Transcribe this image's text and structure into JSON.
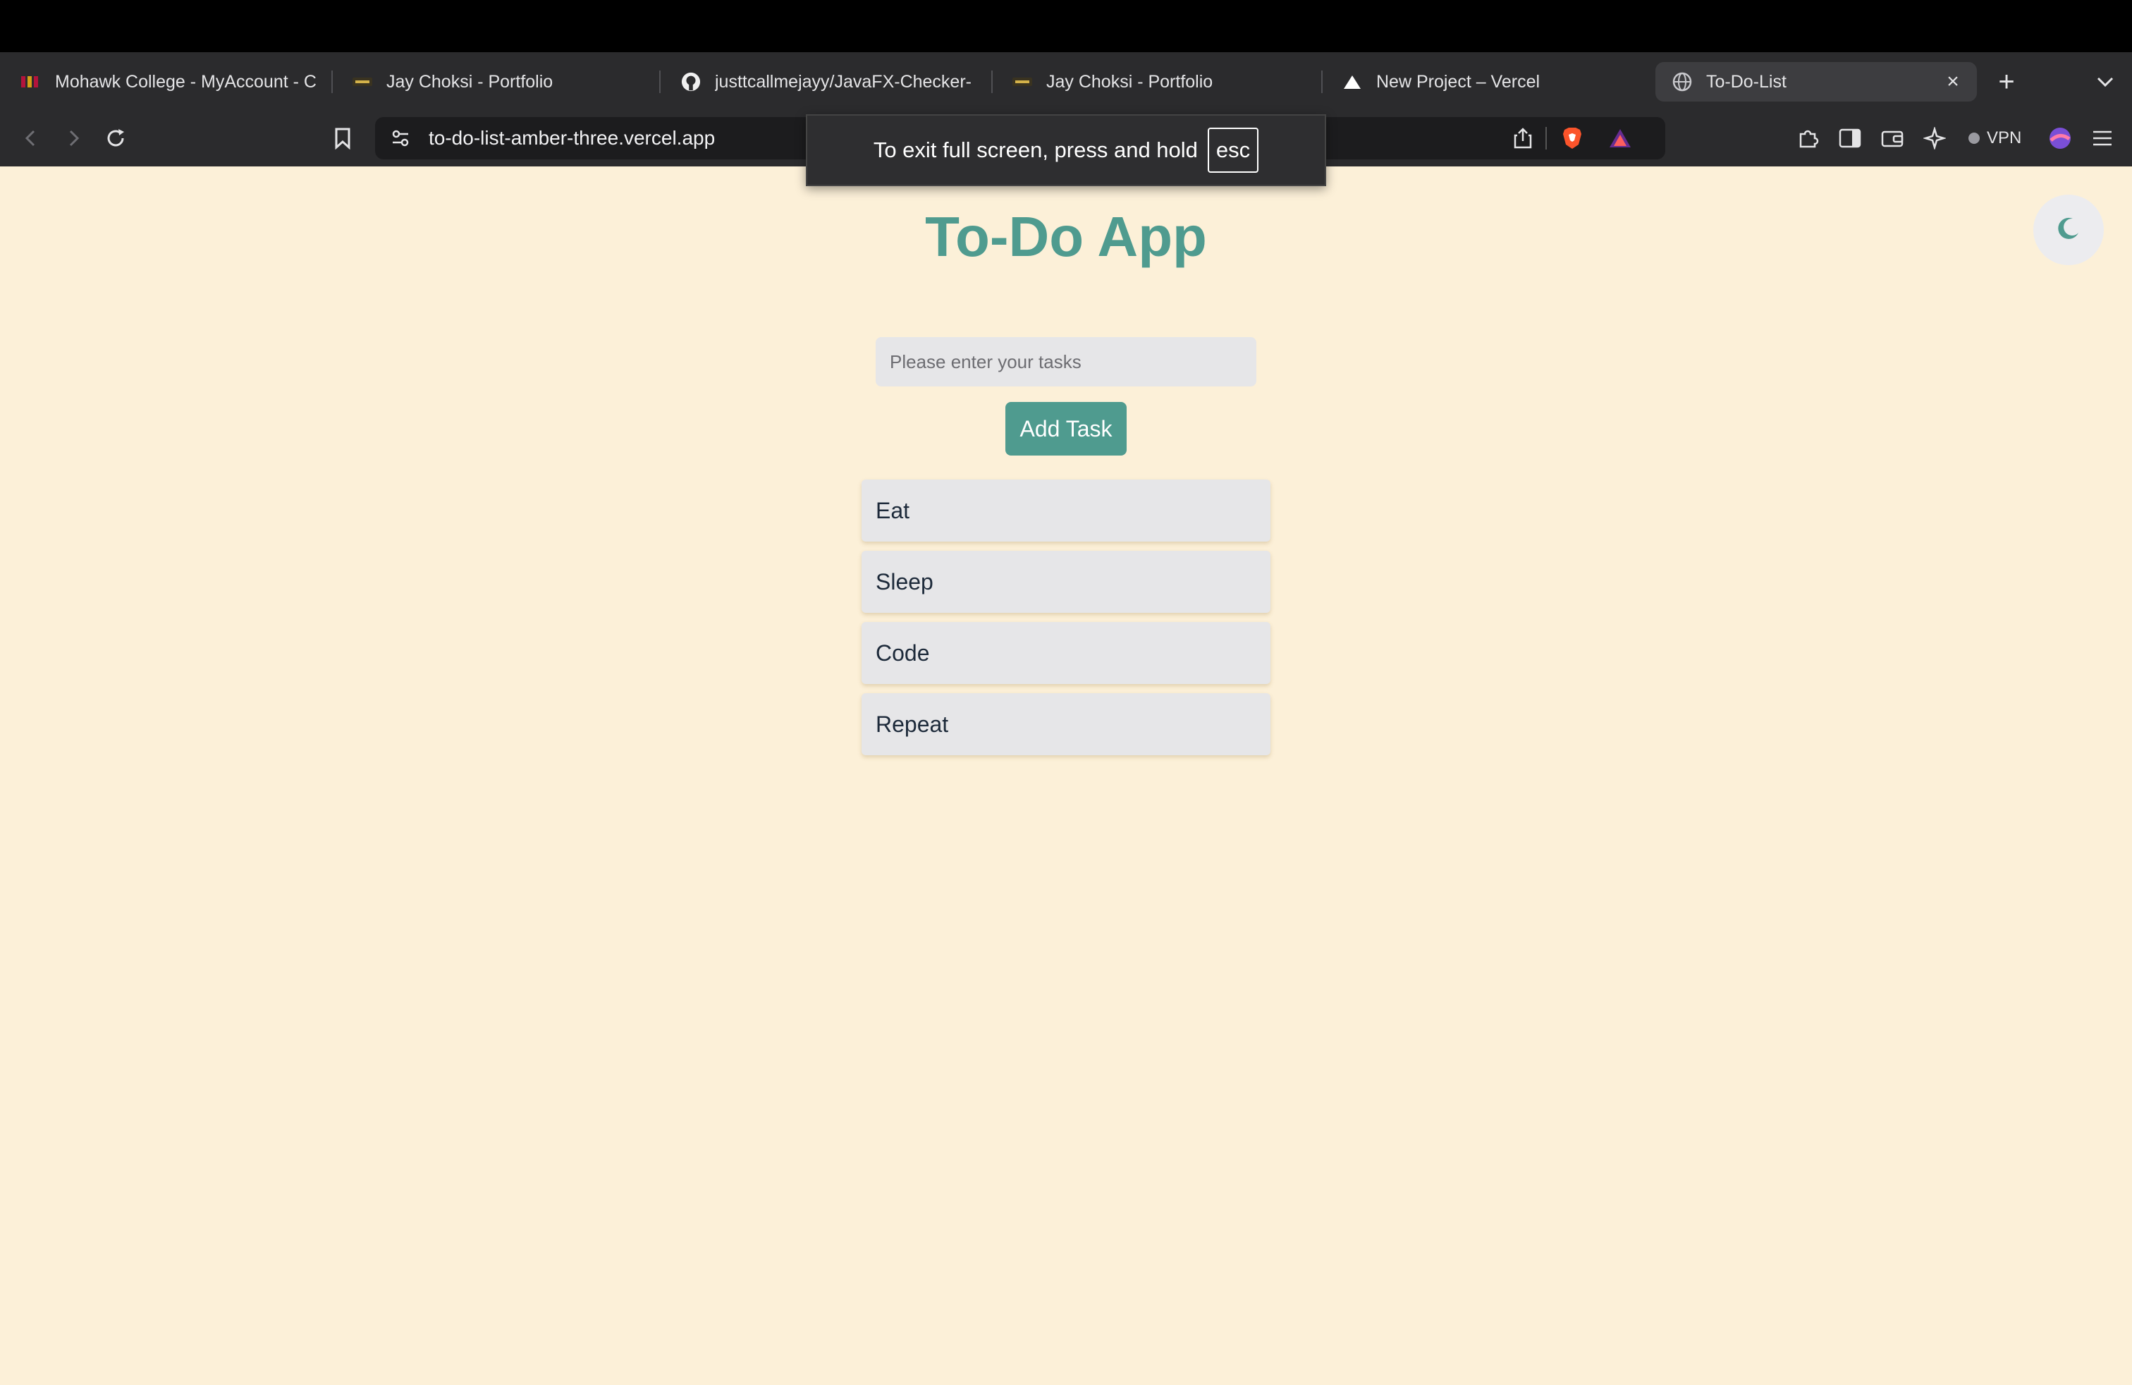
{
  "browser": {
    "tabs": [
      {
        "label": "Mohawk College - MyAccount - C",
        "icon": "mohawk-favicon"
      },
      {
        "label": "Jay Choksi - Portfolio",
        "icon": "portfolio-favicon"
      },
      {
        "label": "justtcallmejayy/JavaFX-Checker-",
        "icon": "github-icon"
      },
      {
        "label": "Jay Choksi - Portfolio",
        "icon": "portfolio-favicon"
      },
      {
        "label": "New Project – Vercel",
        "icon": "vercel-icon"
      },
      {
        "label": "To-Do-List",
        "icon": "globe-icon",
        "active": true
      }
    ],
    "new_tab_icon": "plus-icon",
    "close_tab_icon": "close-icon",
    "url": "to-do-list-amber-three.vercel.app",
    "vpn_label": "VPN",
    "fullscreen_notice": {
      "text": "To exit full screen, press and hold",
      "key": "esc"
    },
    "colors": {
      "chrome_bg": "#2b2b2d",
      "url_bg": "#1c1c1e"
    }
  },
  "app": {
    "title": "To-Do App",
    "input_placeholder": "Please enter your tasks",
    "add_button_label": "Add Task",
    "tasks": [
      "Eat",
      "Sleep",
      "Code",
      "Repeat"
    ],
    "theme_toggle_icon": "moon-icon",
    "colors": {
      "background": "#fcf0d8",
      "accent": "#4f9b8f",
      "task_bg": "#e6e6e8"
    }
  }
}
